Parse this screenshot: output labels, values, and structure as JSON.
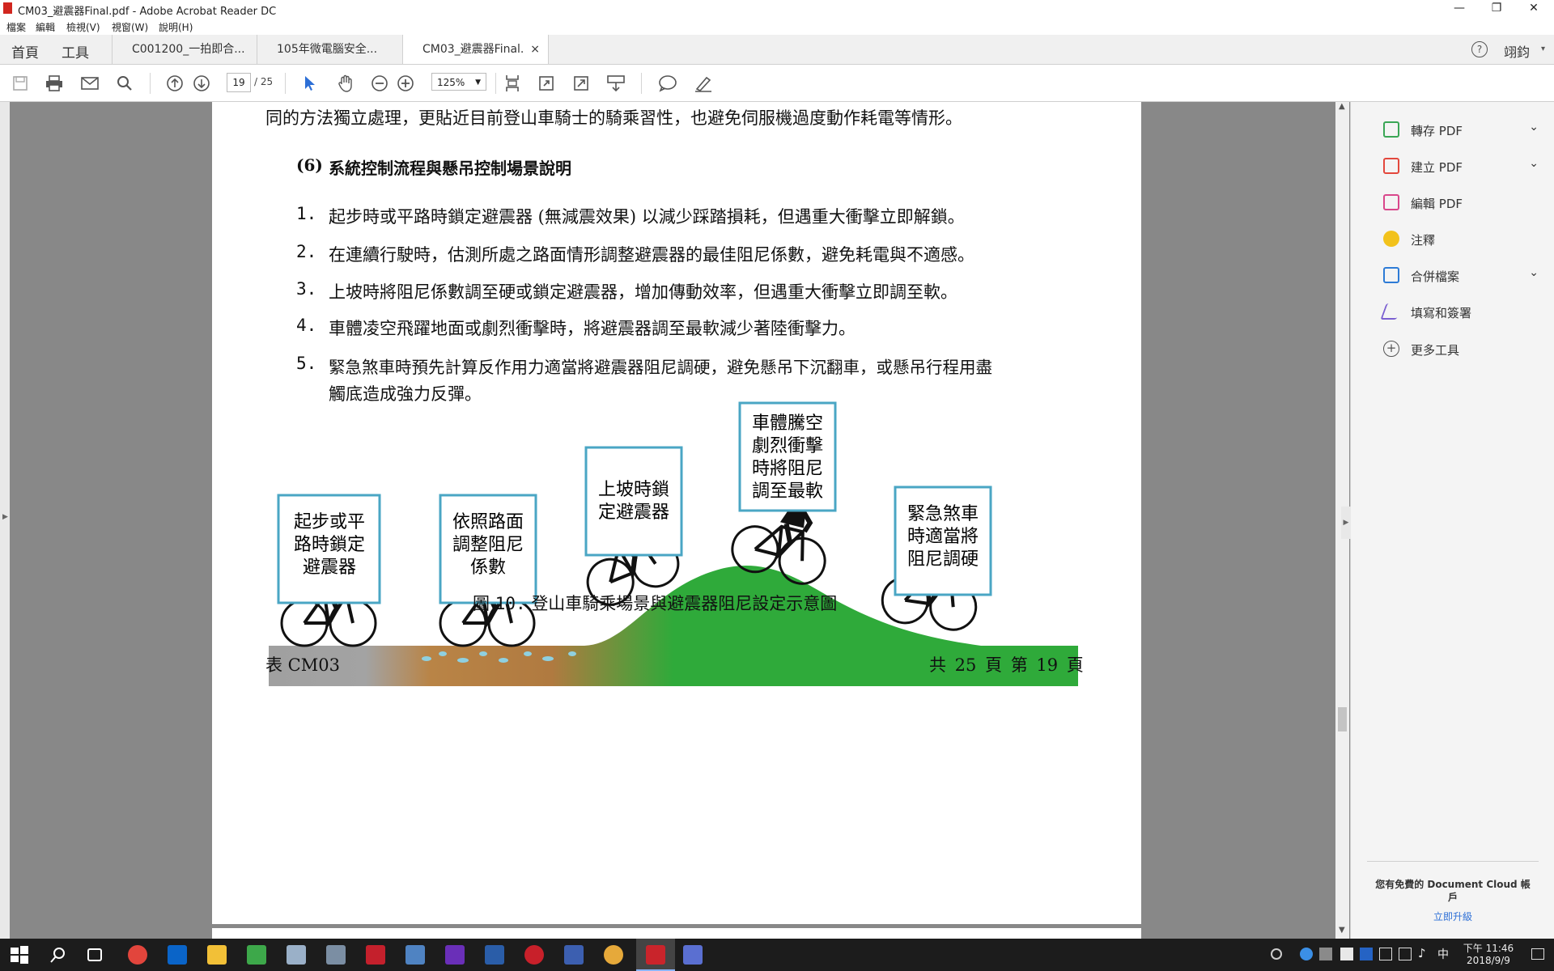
{
  "window": {
    "title": "CM03_避震器Final.pdf - Adobe Acrobat Reader DC",
    "minimize": "—",
    "maximize": "❐",
    "close": "✕"
  },
  "menu": [
    "檔案",
    "編輯",
    "檢視(V)",
    "視窗(W)",
    "說明(H)"
  ],
  "nav": {
    "home": "首頁",
    "tools": "工具",
    "user": "翊鈞",
    "help_icon": "?"
  },
  "tabs": [
    {
      "label": "C001200_一拍即合..."
    },
    {
      "label": "105年微電腦安全..."
    },
    {
      "label": "CM03_避震器Final.",
      "close": "×"
    }
  ],
  "toolbar": {
    "page_current": "19",
    "page_total": "/ 25",
    "zoom": "125%",
    "icons": [
      "save-icon",
      "print-icon",
      "email-icon",
      "search-icon",
      "page-up-icon",
      "page-down-icon",
      "select-arrow-icon",
      "hand-icon",
      "zoom-out-icon",
      "zoom-in-icon",
      "fit-page-icon",
      "rotate-icon",
      "fullscreen-icon",
      "scroll-mode-icon",
      "comment-icon",
      "sign-icon"
    ]
  },
  "document": {
    "intro_line": "同的方法獨立處理，更貼近目前登山車騎士的騎乘習性，也避免伺服機過度動作耗電等情形。",
    "section_num": "(6)",
    "section_title": "系統控制流程與懸吊控制場景說明",
    "items": [
      {
        "num": "1.",
        "text": "起步時或平路時鎖定避震器 (無減震效果) 以減少踩踏損耗，但遇重大衝擊立即解鎖。"
      },
      {
        "num": "2.",
        "text": "在連續行駛時，估測所處之路面情形調整避震器的最佳阻尼係數，避免耗電與不適感。"
      },
      {
        "num": "3.",
        "text": "上坡時將阻尼係數調至硬或鎖定避震器，增加傳動效率，但遇重大衝擊立即調至軟。"
      },
      {
        "num": "4.",
        "text": "車體凌空飛躍地面或劇烈衝擊時，將避震器調至最軟減少著陸衝擊力。"
      },
      {
        "num": "5.",
        "text": "緊急煞車時預先計算反作用力適當將避震器阻尼調硬，避免懸吊下沉翻車，或懸吊行程用盡",
        "text2": "觸底造成強力反彈。"
      }
    ],
    "figure_boxes": [
      {
        "lines": [
          "起步或平",
          "路時鎖定",
          "避震器"
        ]
      },
      {
        "lines": [
          "依照路面",
          "調整阻尼",
          "係數"
        ]
      },
      {
        "lines": [
          "上坡時鎖",
          "定避震器"
        ]
      },
      {
        "lines": [
          "車體騰空",
          "劇烈衝擊",
          "時將阻尼",
          "調至最軟"
        ]
      },
      {
        "lines": [
          "緊急煞車",
          "時適當將",
          "阻尼調硬"
        ]
      }
    ],
    "figure_caption_prefix": "圖",
    "figure_caption_num": "10.",
    "figure_caption_text": "登山車騎乘場景與避震器阻尼設定示意圖",
    "footer_left": "表 CM03",
    "footer_right": "共 25 頁 第 19 頁"
  },
  "right_panel": {
    "items": [
      {
        "label": "轉存 PDF",
        "icon": "export-pdf-icon",
        "color": "#3aa655",
        "chevron": true
      },
      {
        "label": "建立 PDF",
        "icon": "create-pdf-icon",
        "color": "#e3483d",
        "chevron": true
      },
      {
        "label": "編輯 PDF",
        "icon": "edit-pdf-icon",
        "color": "#d9478b",
        "chevron": false
      },
      {
        "label": "注釋",
        "icon": "comment-icon",
        "color": "#f2c21b",
        "chevron": false
      },
      {
        "label": "合併檔案",
        "icon": "combine-icon",
        "color": "#2d7bd6",
        "chevron": true
      },
      {
        "label": "填寫和簽署",
        "icon": "fill-sign-icon",
        "color": "#7a5fd1",
        "chevron": false
      },
      {
        "label": "更多工具",
        "icon": "more-tools-icon",
        "color": "#555555",
        "chevron": false
      }
    ],
    "promo_line1": "您有免費的 Document Cloud 帳",
    "promo_line2": "戶",
    "upgrade_link": "立即升級"
  },
  "taskbar": {
    "time": "下午 11:46",
    "date": "2018/9/9",
    "ime": "中",
    "icons": [
      "start-icon",
      "search-icon",
      "task-view-icon",
      "chrome-icon",
      "outlook-icon",
      "file-explorer-icon",
      "app-icon",
      "app-icon",
      "tools-icon",
      "filezilla-icon",
      "app-icon",
      "visual-studio-icon",
      "word-icon",
      "app-icon",
      "visio-icon",
      "paint-icon",
      "acrobat-icon",
      "app-icon"
    ]
  }
}
